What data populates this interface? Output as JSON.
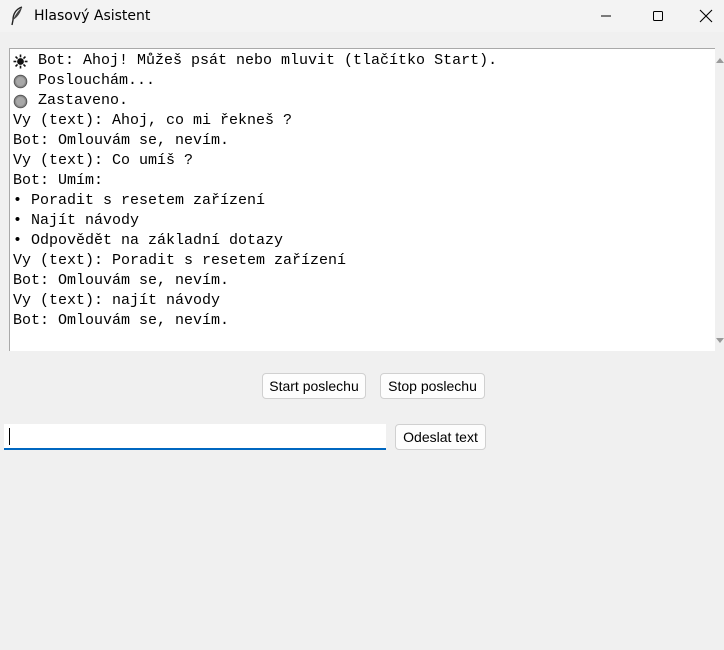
{
  "window": {
    "title": "Hlasový Asistent",
    "icon": "feather-icon"
  },
  "log": {
    "lines": [
      {
        "icon": "sun-icon",
        "text": "Bot: Ahoj! Můžeš psát nebo mluvit (tlačítko Start)."
      },
      {
        "icon": "gray-circle-icon",
        "text": "Poslouchám..."
      },
      {
        "icon": "gray-circle-icon",
        "text": "Zastaveno."
      },
      {
        "icon": "",
        "text": "Vy (text): Ahoj, co mi řekneš ?"
      },
      {
        "icon": "",
        "text": "Bot: Omlouvám se, nevím."
      },
      {
        "icon": "",
        "text": "Vy (text): Co umíš ?"
      },
      {
        "icon": "",
        "text": "Bot: Umím:"
      },
      {
        "icon": "",
        "text": "• Poradit s resetem zařízení"
      },
      {
        "icon": "",
        "text": "• Najít návody"
      },
      {
        "icon": "",
        "text": "• Odpovědět na základní dotazy"
      },
      {
        "icon": "",
        "text": "Vy (text): Poradit s resetem zařízení"
      },
      {
        "icon": "",
        "text": "Bot: Omlouvám se, nevím."
      },
      {
        "icon": "",
        "text": "Vy (text): najít návody"
      },
      {
        "icon": "",
        "text": "Bot: Omlouvám se, nevím."
      }
    ]
  },
  "controls": {
    "start_label": "Start poslechu",
    "stop_label": "Stop poslechu",
    "send_label": "Odeslat text",
    "input_value": ""
  },
  "colors": {
    "input_focus": "#0067c0",
    "status_circle": "#8c8c8c"
  }
}
